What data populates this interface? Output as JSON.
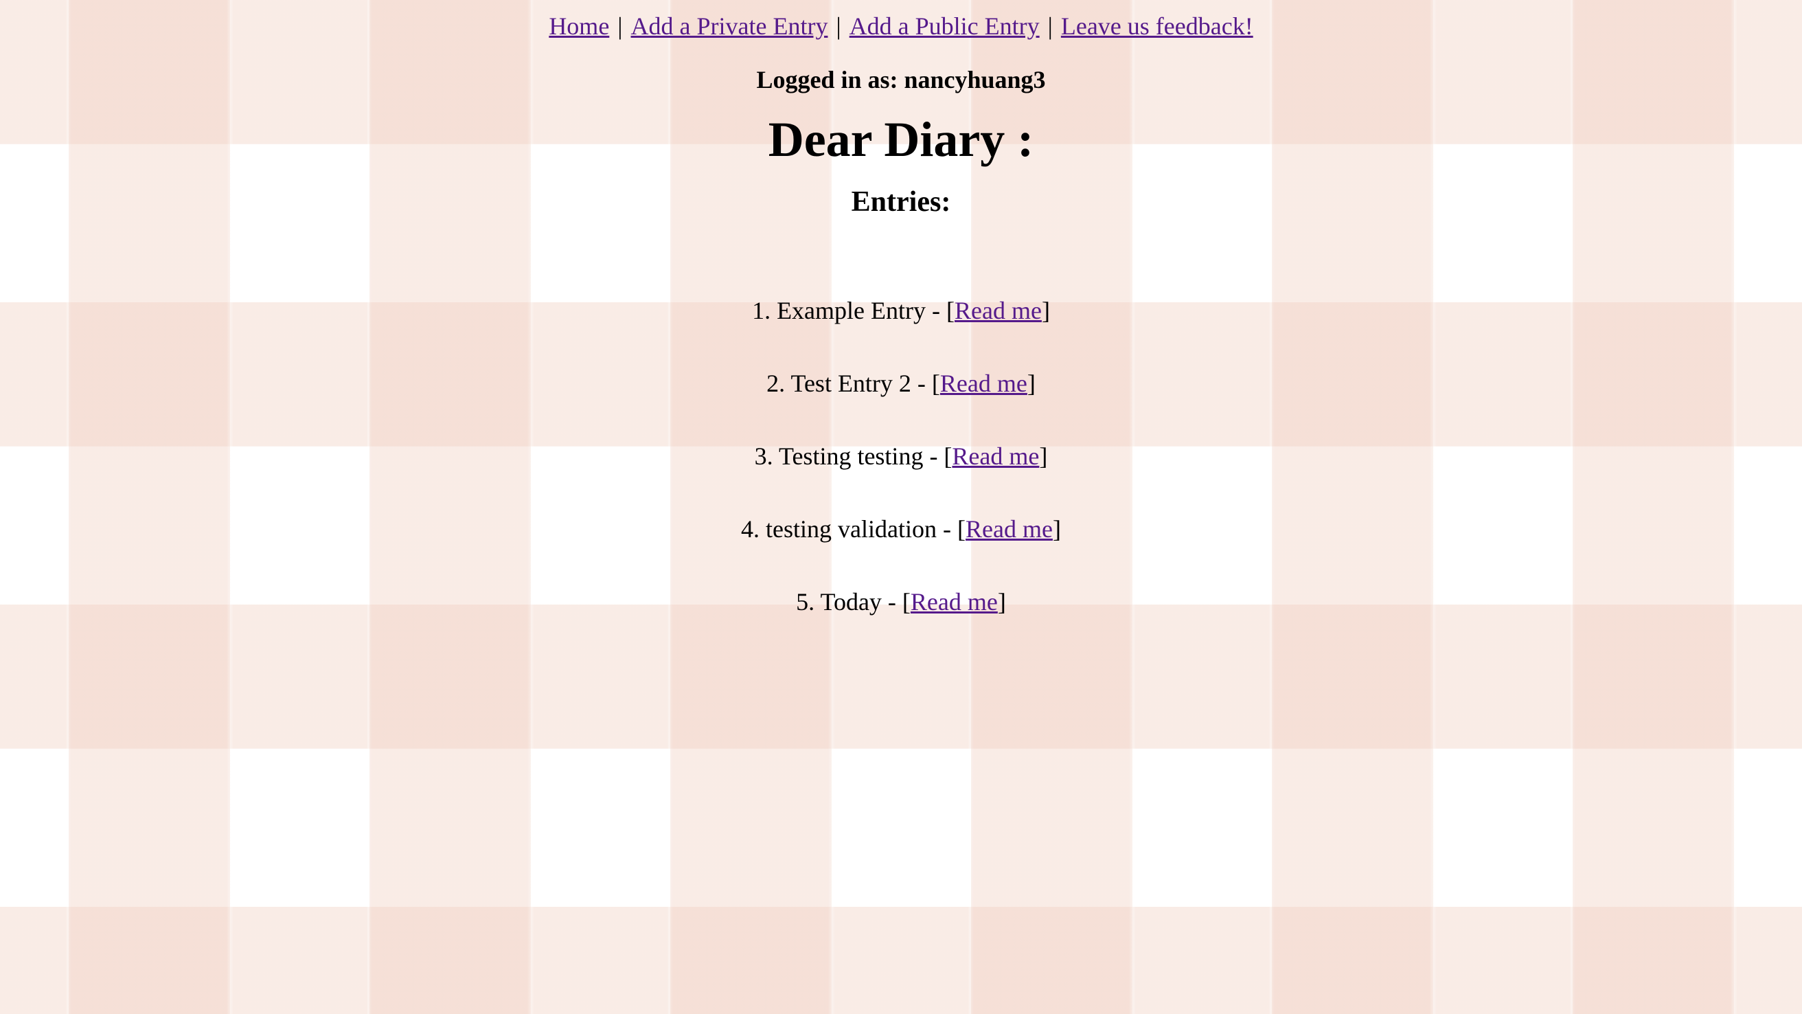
{
  "nav": {
    "home": "Home",
    "add_private": "Add a Private Entry",
    "add_public": "Add a Public Entry",
    "feedback": "Leave us feedback!",
    "separator": "|"
  },
  "logged_in": "Logged in as: nancyhuang3",
  "title": "Dear Diary :",
  "entries_heading": "Entries:",
  "entries": [
    {
      "prefix": "1. Example Entry - [",
      "link": "Read me",
      "suffix": "]"
    },
    {
      "prefix": "2. Test Entry 2 - [",
      "link": "Read me",
      "suffix": "]"
    },
    {
      "prefix": "3. Testing testing - [",
      "link": "Read me",
      "suffix": "]"
    },
    {
      "prefix": "4. testing validation - [",
      "link": "Read me",
      "suffix": "]"
    },
    {
      "prefix": "5. Today - [",
      "link": "Read me",
      "suffix": "]"
    }
  ],
  "colors": {
    "link": "#551a8b",
    "gingham": "#f0cdbe"
  }
}
